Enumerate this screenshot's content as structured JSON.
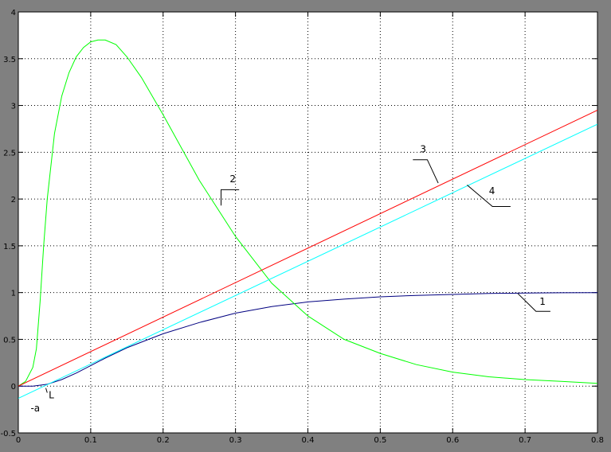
{
  "chart_data": {
    "type": "line",
    "title": "",
    "xlabel": "",
    "ylabel": "",
    "xlim": [
      0,
      0.8
    ],
    "ylim": [
      -0.5,
      4
    ],
    "grid": true,
    "x_ticks": [
      0,
      0.1,
      0.2,
      0.3,
      0.4,
      0.5,
      0.6,
      0.7,
      0.8
    ],
    "x_tick_labels": [
      "0",
      "0.1",
      "0.2",
      "0.3",
      "0.4",
      "0.5",
      "0.6",
      "0.7",
      "0.8"
    ],
    "y_ticks": [
      -0.5,
      0,
      0.5,
      1,
      1.5,
      2,
      2.5,
      3,
      3.5,
      4
    ],
    "y_tick_labels": [
      "-0.5",
      "0",
      "0.5",
      "1",
      "1.5",
      "2",
      "2.5",
      "3",
      "3.5",
      "4"
    ],
    "series": [
      {
        "id": "curve-1",
        "color": "#000080",
        "x": [
          0,
          0.02,
          0.04,
          0.06,
          0.08,
          0.1,
          0.12,
          0.15,
          0.2,
          0.25,
          0.3,
          0.35,
          0.4,
          0.45,
          0.5,
          0.55,
          0.6,
          0.65,
          0.7,
          0.75,
          0.8
        ],
        "y": [
          0,
          0.0,
          0.02,
          0.07,
          0.14,
          0.22,
          0.3,
          0.41,
          0.56,
          0.68,
          0.78,
          0.85,
          0.9,
          0.93,
          0.955,
          0.97,
          0.98,
          0.99,
          0.995,
          0.998,
          1.0
        ]
      },
      {
        "id": "curve-2",
        "color": "#00ff00",
        "x": [
          0,
          0.01,
          0.02,
          0.025,
          0.03,
          0.035,
          0.04,
          0.05,
          0.06,
          0.07,
          0.08,
          0.09,
          0.1,
          0.11,
          0.12,
          0.135,
          0.15,
          0.17,
          0.2,
          0.25,
          0.3,
          0.35,
          0.4,
          0.45,
          0.5,
          0.55,
          0.6,
          0.65,
          0.7,
          0.75,
          0.8
        ],
        "y": [
          0,
          0.05,
          0.2,
          0.4,
          0.9,
          1.5,
          2.0,
          2.7,
          3.1,
          3.35,
          3.52,
          3.62,
          3.68,
          3.7,
          3.7,
          3.65,
          3.52,
          3.3,
          2.9,
          2.2,
          1.6,
          1.1,
          0.75,
          0.5,
          0.35,
          0.23,
          0.15,
          0.1,
          0.07,
          0.05,
          0.03
        ]
      },
      {
        "id": "curve-3",
        "color": "#ff0000",
        "x": [
          0,
          0.8
        ],
        "y": [
          0,
          2.95
        ]
      },
      {
        "id": "curve-4",
        "color": "#00ffff",
        "x": [
          0,
          0.8
        ],
        "y": [
          -0.13,
          2.8
        ]
      }
    ],
    "annotations": [
      {
        "id": "label-1",
        "text": "1",
        "x": 0.72,
        "y": 0.87,
        "leader": [
          [
            0.69,
            0.99
          ],
          [
            0.715,
            0.8
          ],
          [
            0.735,
            0.8
          ]
        ]
      },
      {
        "id": "label-2",
        "text": "2",
        "x": 0.292,
        "y": 2.18,
        "leader": [
          [
            0.28,
            1.93
          ],
          [
            0.28,
            2.1
          ],
          [
            0.305,
            2.1
          ]
        ]
      },
      {
        "id": "label-3",
        "text": "3",
        "x": 0.555,
        "y": 2.5,
        "leader": [
          [
            0.58,
            2.17
          ],
          [
            0.565,
            2.42
          ],
          [
            0.545,
            2.42
          ]
        ]
      },
      {
        "id": "label-4",
        "text": "4",
        "x": 0.65,
        "y": 2.05,
        "leader": [
          [
            0.62,
            2.15
          ],
          [
            0.655,
            1.92
          ],
          [
            0.68,
            1.92
          ]
        ]
      },
      {
        "id": "label-L",
        "text": "L",
        "x": 0.042,
        "y": -0.13,
        "leader": [
          [
            0.038,
            -0.02
          ],
          [
            0.04,
            -0.07
          ]
        ]
      },
      {
        "id": "label-a",
        "text": "-a",
        "x": 0.017,
        "y": -0.27
      }
    ]
  }
}
